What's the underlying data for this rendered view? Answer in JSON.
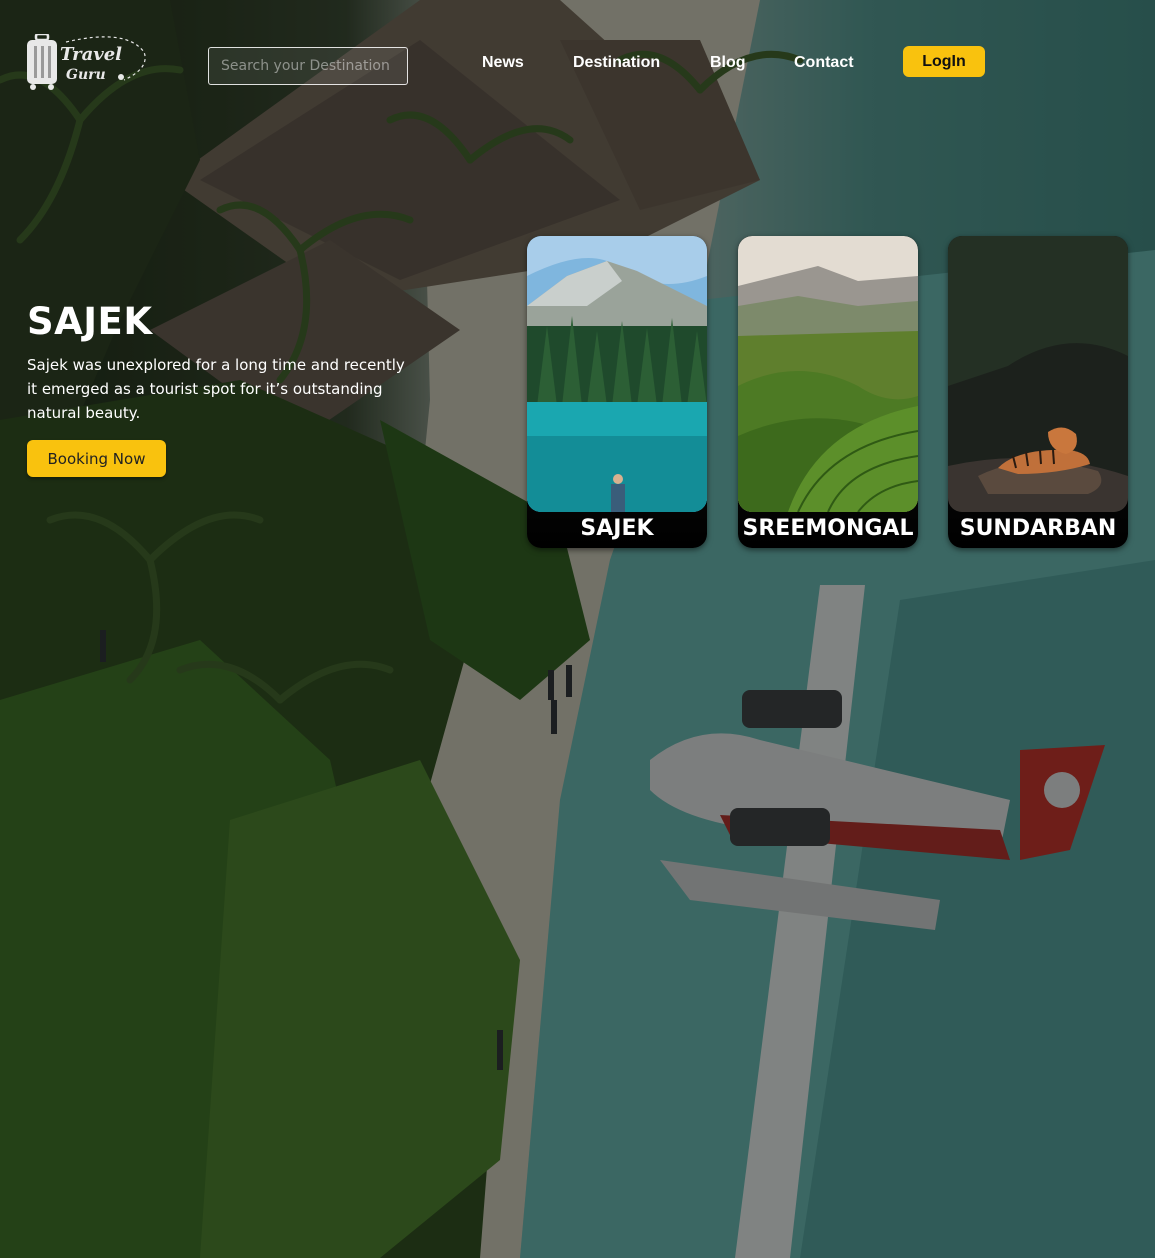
{
  "brand": {
    "line1": "Travel",
    "line2": "Guru"
  },
  "search": {
    "placeholder": "Search your Destination"
  },
  "nav": {
    "items": [
      "News",
      "Destination",
      "Blog",
      "Contact"
    ],
    "login_label": "LogIn"
  },
  "hero": {
    "title": "SAJEK",
    "description": "Sajek was unexplored for a long time and recently it emerged as a tourist spot for it’s outstanding natural beauty.",
    "button_label": "Booking Now"
  },
  "destinations": [
    "SAJEK",
    "SREEMONGAL",
    "SUNDARBAN"
  ],
  "colors": {
    "accent": "#f9c20e",
    "card_bg": "#111111"
  }
}
